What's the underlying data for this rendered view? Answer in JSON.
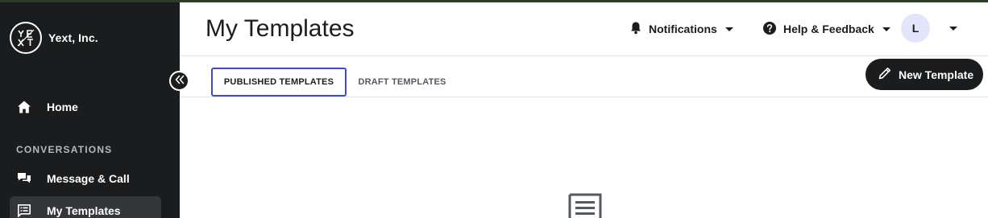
{
  "app": {
    "org_name": "Yext, Inc.",
    "logo_text": "YEXT"
  },
  "sidebar": {
    "collapse_icon": "double-chevron-left-icon",
    "home": {
      "label": "Home",
      "icon": "home-icon"
    },
    "section_conversations": "CONVERSATIONS",
    "items": [
      {
        "label": "Message & Call",
        "icon": "chat-bubbles-icon"
      },
      {
        "label": "My Templates",
        "icon": "template-list-icon",
        "active": true
      }
    ]
  },
  "header": {
    "title": "My Templates",
    "notifications_label": "Notifications",
    "help_label": "Help & Feedback",
    "avatar_initial": "L"
  },
  "tabs": [
    {
      "label": "PUBLISHED TEMPLATES",
      "active": true
    },
    {
      "label": "DRAFT TEMPLATES",
      "active": false
    }
  ],
  "actions": {
    "new_template_label": "New Template",
    "new_template_icon": "pencil-icon"
  },
  "main": {
    "empty_state_icon": "message-icon"
  },
  "colors": {
    "sidebar_bg": "#1b1c1d",
    "active_nav_bg": "#34363a",
    "tab_focus_border": "#3e4bc6",
    "avatar_bg": "#e3e6fa"
  }
}
